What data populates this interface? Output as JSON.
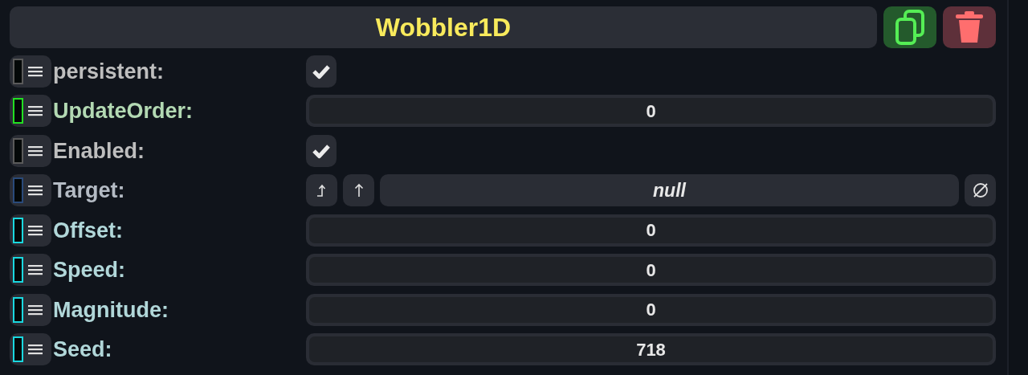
{
  "header": {
    "title": "Wobbler1D"
  },
  "fields": [
    {
      "kind": "checkbox",
      "label": "persistent:",
      "color": "#5a5a5a",
      "checked": true
    },
    {
      "kind": "number",
      "label": "UpdateOrder:",
      "color": "#22e022",
      "value": "0"
    },
    {
      "kind": "checkbox",
      "label": "Enabled:",
      "color": "#5a5a5a",
      "checked": true
    },
    {
      "kind": "reference",
      "label": "Target:",
      "color": "#2a4a7a",
      "value": "null"
    },
    {
      "kind": "number",
      "label": "Offset:",
      "color": "#1ad8e0",
      "value": "0"
    },
    {
      "kind": "number",
      "label": "Speed:",
      "color": "#1ad8e0",
      "value": "0"
    },
    {
      "kind": "number",
      "label": "Magnitude:",
      "color": "#1ad8e0",
      "value": "0"
    },
    {
      "kind": "number",
      "label": "Seed:",
      "color": "#1ad8e0",
      "value": "718"
    }
  ]
}
